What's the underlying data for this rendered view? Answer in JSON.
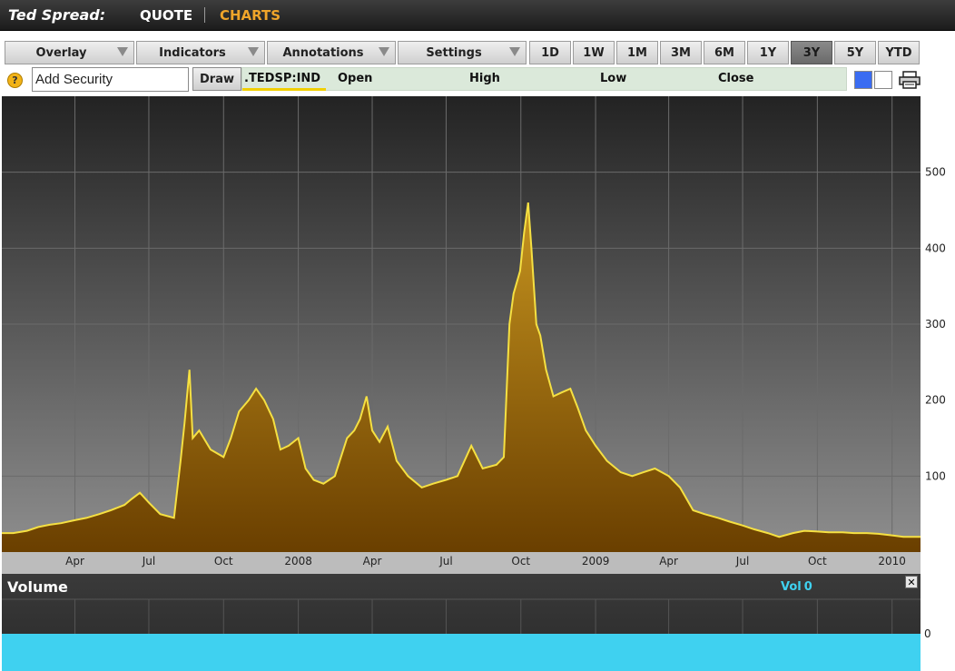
{
  "header": {
    "title": "Ted Spread:",
    "nav": [
      {
        "label": "QUOTE",
        "color": "#ffffff"
      },
      {
        "label": "CHARTS",
        "color": "#f0a52a"
      }
    ]
  },
  "toolbar": {
    "dropdowns": [
      "Overlay",
      "Indicators",
      "Annotations",
      "Settings"
    ],
    "ranges": [
      "1D",
      "1W",
      "1M",
      "3M",
      "6M",
      "1Y",
      "3Y",
      "5Y",
      "YTD"
    ],
    "active_range": "3Y"
  },
  "security": {
    "input_value": "Add Security",
    "draw_label": "Draw",
    "ticker": ".TEDSP:IND",
    "fields": [
      {
        "label": "Open",
        "value": ""
      },
      {
        "label": "High",
        "value": ""
      },
      {
        "label": "Low",
        "value": ""
      },
      {
        "label": "Close",
        "value": ""
      }
    ],
    "color_options": [
      "#3a6cf2",
      "#ffffff"
    ]
  },
  "volume": {
    "title": "Volume",
    "label": "Vol",
    "value": "0",
    "axis_ticks": [
      "0"
    ]
  },
  "colors": {
    "accent": "#f0a52a",
    "line": "#f5e042",
    "fill_top": "#c7951f",
    "fill_bottom": "#6a3f00",
    "volume_bar": "#3fd1f0"
  },
  "chart_data": {
    "type": "area",
    "title": "",
    "xlabel": "",
    "ylabel": "",
    "ylim": [
      0,
      600
    ],
    "y_ticks": [
      100,
      200,
      300,
      400,
      500
    ],
    "x_tick_labels": [
      "Apr",
      "Jul",
      "Oct",
      "2008",
      "Apr",
      "Jul",
      "Oct",
      "2009",
      "Apr",
      "Jul",
      "Oct",
      "2010"
    ],
    "x_tick_dates": [
      "2007-04-01",
      "2007-07-01",
      "2007-10-01",
      "2008-01-01",
      "2008-04-01",
      "2008-07-01",
      "2008-10-01",
      "2009-01-01",
      "2009-04-01",
      "2009-07-01",
      "2009-10-01",
      "2010-01-01"
    ],
    "grid": true,
    "legend": "none",
    "series": [
      {
        "x": [
          "2007-01-15",
          "2007-02-01",
          "2007-02-15",
          "2007-03-01",
          "2007-03-15",
          "2007-04-01",
          "2007-04-15",
          "2007-05-01",
          "2007-05-15",
          "2007-06-01",
          "2007-06-10",
          "2007-06-20",
          "2007-07-01",
          "2007-07-15",
          "2007-08-01",
          "2007-08-09",
          "2007-08-14",
          "2007-08-20",
          "2007-08-24",
          "2007-09-01",
          "2007-09-15",
          "2007-10-01",
          "2007-10-10",
          "2007-10-20",
          "2007-11-01",
          "2007-11-10",
          "2007-11-20",
          "2007-12-01",
          "2007-12-10",
          "2007-12-20",
          "2008-01-01",
          "2008-01-10",
          "2008-01-20",
          "2008-02-01",
          "2008-02-15",
          "2008-03-01",
          "2008-03-10",
          "2008-03-17",
          "2008-03-25",
          "2008-04-01",
          "2008-04-10",
          "2008-04-20",
          "2008-05-01",
          "2008-05-15",
          "2008-06-01",
          "2008-06-15",
          "2008-07-01",
          "2008-07-15",
          "2008-08-01",
          "2008-08-15",
          "2008-09-01",
          "2008-09-10",
          "2008-09-17",
          "2008-09-22",
          "2008-09-30",
          "2008-10-05",
          "2008-10-10",
          "2008-10-14",
          "2008-10-20",
          "2008-10-25",
          "2008-11-01",
          "2008-11-10",
          "2008-11-20",
          "2008-12-01",
          "2008-12-10",
          "2008-12-20",
          "2009-01-01",
          "2009-01-15",
          "2009-02-01",
          "2009-02-15",
          "2009-03-01",
          "2009-03-15",
          "2009-04-01",
          "2009-04-15",
          "2009-05-01",
          "2009-05-15",
          "2009-06-01",
          "2009-06-15",
          "2009-07-01",
          "2009-07-15",
          "2009-08-01",
          "2009-08-15",
          "2009-09-01",
          "2009-09-15",
          "2009-10-01",
          "2009-10-15",
          "2009-11-01",
          "2009-11-15",
          "2009-12-01",
          "2009-12-15",
          "2010-01-01",
          "2010-01-15"
        ],
        "values": [
          25,
          28,
          33,
          36,
          38,
          42,
          45,
          50,
          55,
          62,
          70,
          78,
          65,
          50,
          45,
          120,
          170,
          240,
          150,
          160,
          135,
          125,
          150,
          185,
          200,
          215,
          200,
          175,
          135,
          140,
          150,
          110,
          95,
          90,
          100,
          150,
          160,
          175,
          205,
          160,
          145,
          165,
          120,
          100,
          85,
          90,
          95,
          100,
          140,
          110,
          115,
          125,
          300,
          340,
          370,
          420,
          460,
          400,
          300,
          285,
          240,
          205,
          210,
          215,
          190,
          160,
          140,
          120,
          105,
          100,
          105,
          110,
          100,
          85,
          55,
          50,
          45,
          40,
          35,
          30,
          25,
          20,
          25,
          28,
          27,
          26,
          26,
          25,
          25,
          24,
          22,
          20
        ]
      }
    ]
  }
}
